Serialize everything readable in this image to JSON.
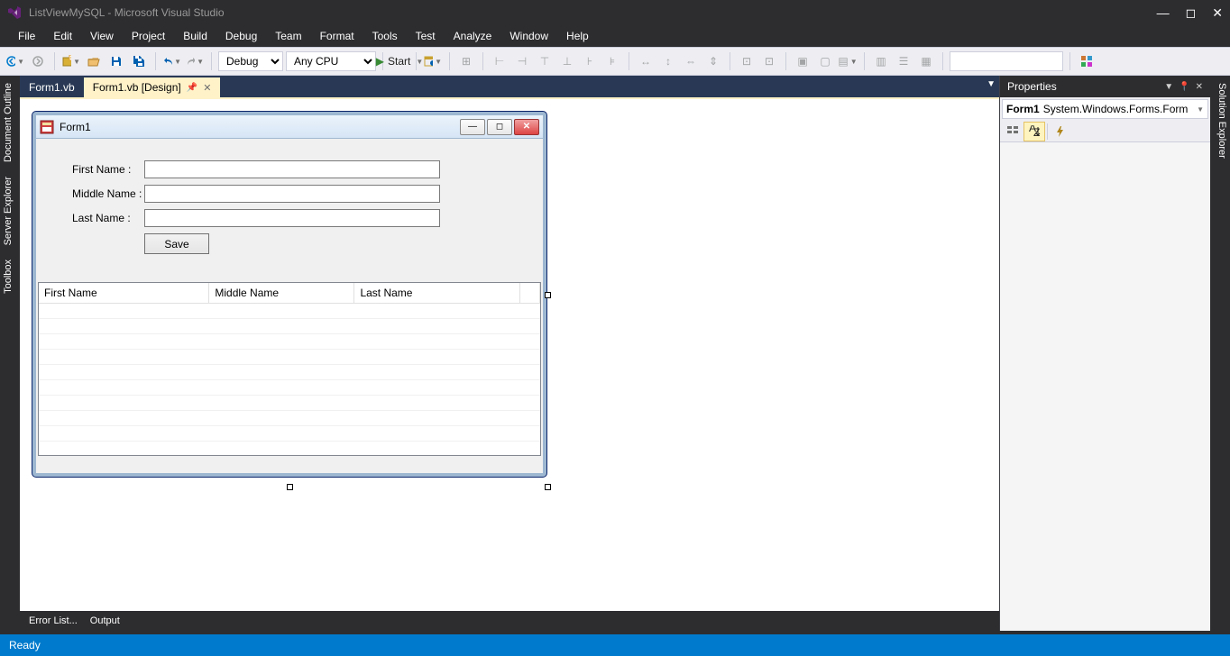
{
  "titlebar": {
    "title": "ListViewMySQL - Microsoft Visual Studio"
  },
  "menu": [
    "File",
    "Edit",
    "View",
    "Project",
    "Build",
    "Debug",
    "Team",
    "Format",
    "Tools",
    "Test",
    "Analyze",
    "Window",
    "Help"
  ],
  "toolbar": {
    "config": "Debug",
    "platform": "Any CPU",
    "start": "Start"
  },
  "left_tabs": [
    "Document Outline",
    "Server Explorer",
    "Toolbox"
  ],
  "right_tabs": [
    "Solution Explorer"
  ],
  "doc_tabs": [
    {
      "label": "Form1.vb",
      "active": false
    },
    {
      "label": "Form1.vb [Design]",
      "active": true
    }
  ],
  "form": {
    "title": "Form1",
    "labels": {
      "first": "First Name :",
      "middle": "Middle Name :",
      "last": "Last Name :"
    },
    "save": "Save",
    "columns": [
      "First Name",
      "Middle Name",
      "Last Name"
    ]
  },
  "properties": {
    "title": "Properties",
    "object_name": "Form1",
    "object_type": "System.Windows.Forms.Form"
  },
  "bottom_tabs": [
    "Error List...",
    "Output"
  ],
  "status": "Ready"
}
